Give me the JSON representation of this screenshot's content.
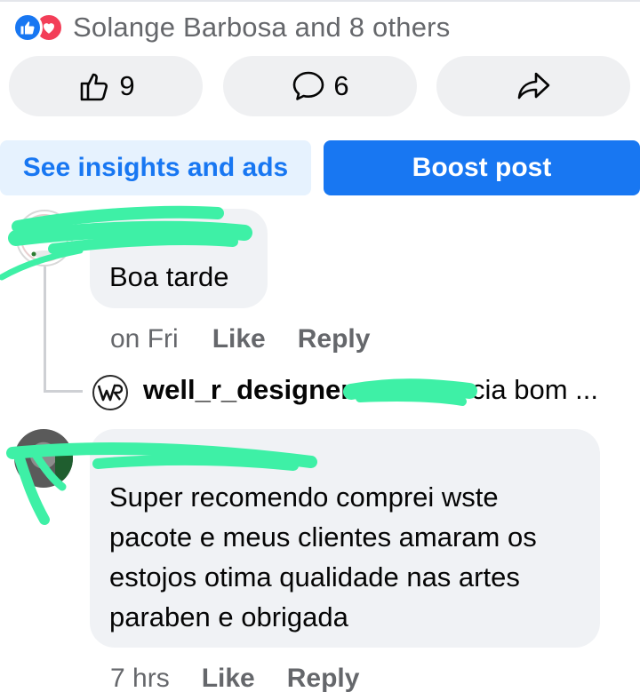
{
  "reactions": {
    "summary": "Solange Barbosa and 8 others",
    "icons": [
      "like-icon",
      "love-icon"
    ],
    "colors": {
      "like": "#1877f2",
      "love": "#f33e58"
    }
  },
  "actions": {
    "like_count": "9",
    "comment_count": "6",
    "icons": [
      "thumbs-up-icon",
      "comment-icon",
      "share-icon"
    ]
  },
  "buttons": {
    "insights": "See insights and ads",
    "boost": "Boost post",
    "colors": {
      "brand": "#1877f2",
      "insights_bg": "#e6f2fe"
    }
  },
  "comments": [
    {
      "text": "Boa tarde",
      "time": "on Fri",
      "like": "Like",
      "reply": "Reply",
      "reply_preview": {
        "author": "well_r_designer",
        "snippet": "cia bom ..."
      }
    },
    {
      "text": "Super recomendo comprei wste pacote e meus clientes amaram os estojos otima qualidade nas artes paraben e obrigada",
      "lines": [
        "Super recomendo comprei wste",
        "pacote e meus clientes amaram os",
        "estojos otima qualidade nas artes",
        "paraben e obrigada"
      ],
      "time": "7 hrs",
      "like": "Like",
      "reply": "Reply"
    }
  ],
  "redaction_color": "#3ef0a6"
}
